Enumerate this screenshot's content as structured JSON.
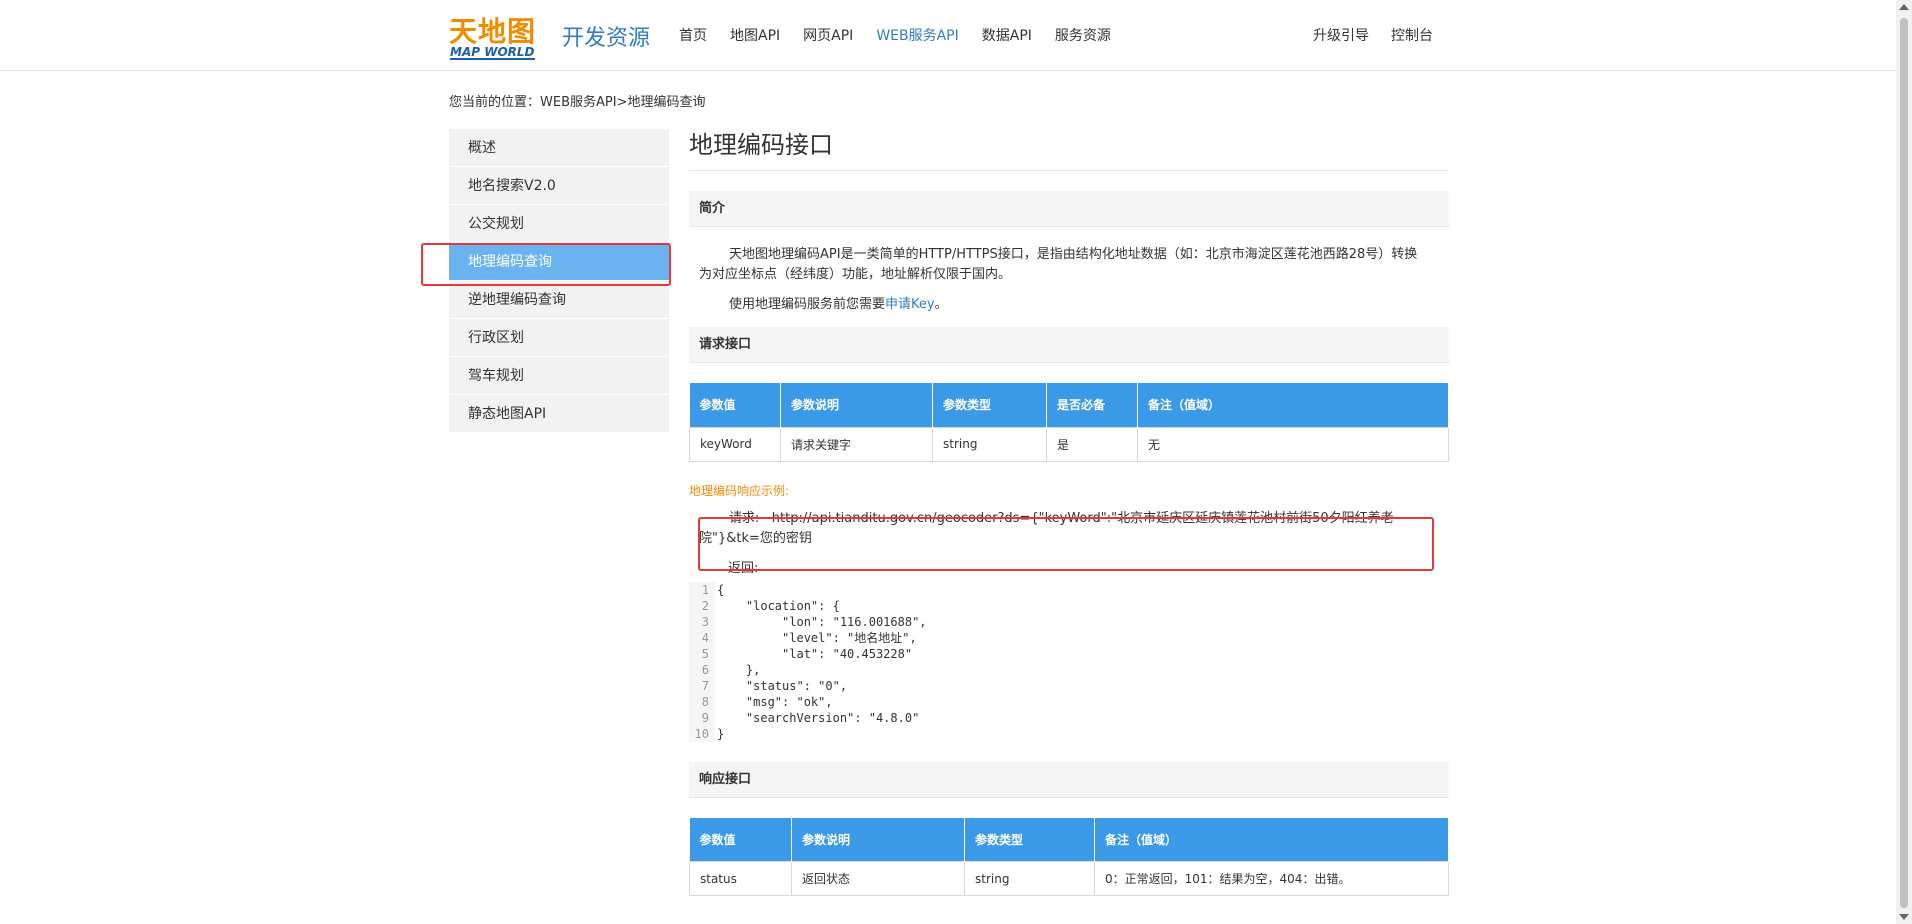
{
  "header": {
    "logo_cn": "天地图",
    "logo_en": "MAP WORLD",
    "site_title": "开发资源",
    "nav": [
      "首页",
      "地图API",
      "网页API",
      "WEB服务API",
      "数据API",
      "服务资源"
    ],
    "nav_right": [
      "升级引导",
      "控制台"
    ]
  },
  "breadcrumb": "您当前的位置：WEB服务API>地理编码查询",
  "sidebar": {
    "items": [
      "概述",
      "地名搜索V2.0",
      "公交规划",
      "地理编码查询",
      "逆地理编码查询",
      "行政区划",
      "驾车规划",
      "静态地图API"
    ]
  },
  "main": {
    "title": "地理编码接口",
    "intro": {
      "heading": "简介",
      "para1": "天地图地理编码API是一类简单的HTTP/HTTPS接口，是指由结构化地址数据（如：北京市海淀区莲花池西路28号）转换为对应坐标点（经纬度）功能，地址解析仅限于国内。",
      "para2_prefix": "使用地理编码服务前您需要",
      "para2_link": "申请Key",
      "para2_suffix": "。"
    },
    "request": {
      "heading": "请求接口",
      "columns": [
        "参数值",
        "参数说明",
        "参数类型",
        "是否必备",
        "备注（值域）"
      ],
      "rows": [
        [
          "keyWord",
          "请求关键字",
          "string",
          "是",
          "无"
        ]
      ]
    },
    "example": {
      "title": "地理编码响应示例:",
      "request_label": "请求:",
      "request_url": "http://api.tianditu.gov.cn/geocoder?ds={\"keyWord\":\"北京市延庆区延庆镇莲花池村前街50夕阳红养老院\"}&tk=您的密钥",
      "return_label": "返回:",
      "code_lines": [
        "{",
        "    \"location\": {",
        "         \"lon\": \"116.001688\",",
        "         \"level\": \"地名地址\",",
        "         \"lat\": \"40.453228\"",
        "    },",
        "    \"status\": \"0\",",
        "    \"msg\": \"ok\",",
        "    \"searchVersion\": \"4.8.0\"",
        "}"
      ]
    },
    "response": {
      "heading": "响应接口",
      "columns": [
        "参数值",
        "参数说明",
        "参数类型",
        "备注（值域）"
      ],
      "rows": [
        [
          "status",
          "返回状态",
          "string",
          "0：正常返回，101：结果为空，404：出错。"
        ]
      ]
    }
  }
}
